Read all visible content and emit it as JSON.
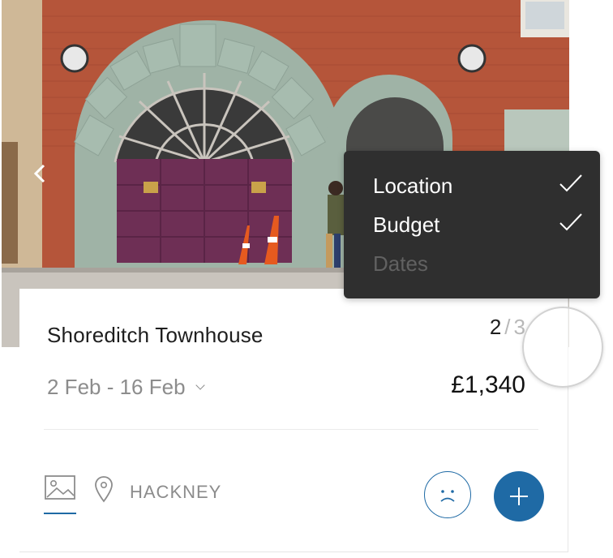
{
  "listing": {
    "title": "Shoreditch Townhouse",
    "pager_current": "2",
    "pager_separator": "/",
    "pager_total": "3",
    "dates": "2 Feb - 16 Feb",
    "price": "£1,340",
    "location": "HACKNEY"
  },
  "filter_menu": {
    "items": [
      {
        "label": "Location",
        "checked": true
      },
      {
        "label": "Budget",
        "checked": true
      },
      {
        "label": "Dates",
        "checked": false
      }
    ]
  },
  "icons": {
    "prev": "chevron-left-icon",
    "dates_dropdown": "chevron-down-icon",
    "gallery": "image-icon",
    "location": "map-pin-icon",
    "dislike": "sad-face-icon",
    "add": "plus-icon",
    "check": "checkmark-icon"
  },
  "colors": {
    "accent": "#1f6aa5",
    "dropdown_bg": "#2f2f2f",
    "muted_text": "#8c8c8c",
    "door": "#6e2f55",
    "brick": "#b5553a",
    "stone": "#9fb3a6"
  }
}
